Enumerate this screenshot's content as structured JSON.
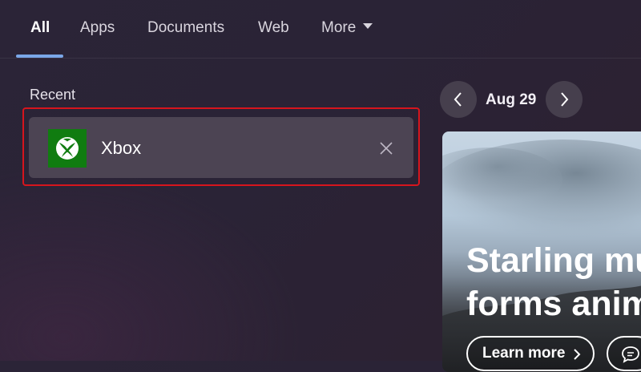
{
  "tabs": [
    {
      "label": "All",
      "active": true
    },
    {
      "label": "Apps",
      "active": false
    },
    {
      "label": "Documents",
      "active": false
    },
    {
      "label": "Web",
      "active": false
    },
    {
      "label": "More",
      "active": false,
      "icon": "caret-down-icon"
    }
  ],
  "recent": {
    "heading": "Recent",
    "items": [
      {
        "name": "Xbox",
        "icon": "xbox-logo-icon",
        "icon_bg": "#107c10",
        "action_icon": "close-icon"
      }
    ],
    "highlight_color": "#d6151d"
  },
  "date_nav": {
    "date": "Aug 29",
    "prev_icon": "chevron-left-icon",
    "next_icon": "chevron-right-icon"
  },
  "hero": {
    "title_line1": "Starling mu",
    "title_line2": "forms anim",
    "cta_label": "Learn more",
    "cta_icon": "chevron-right-icon",
    "secondary_icon": "chat-bubble-icon"
  },
  "colors": {
    "accent": "#7aa7e8",
    "background": "#2a2336",
    "card": "#4c4453"
  }
}
